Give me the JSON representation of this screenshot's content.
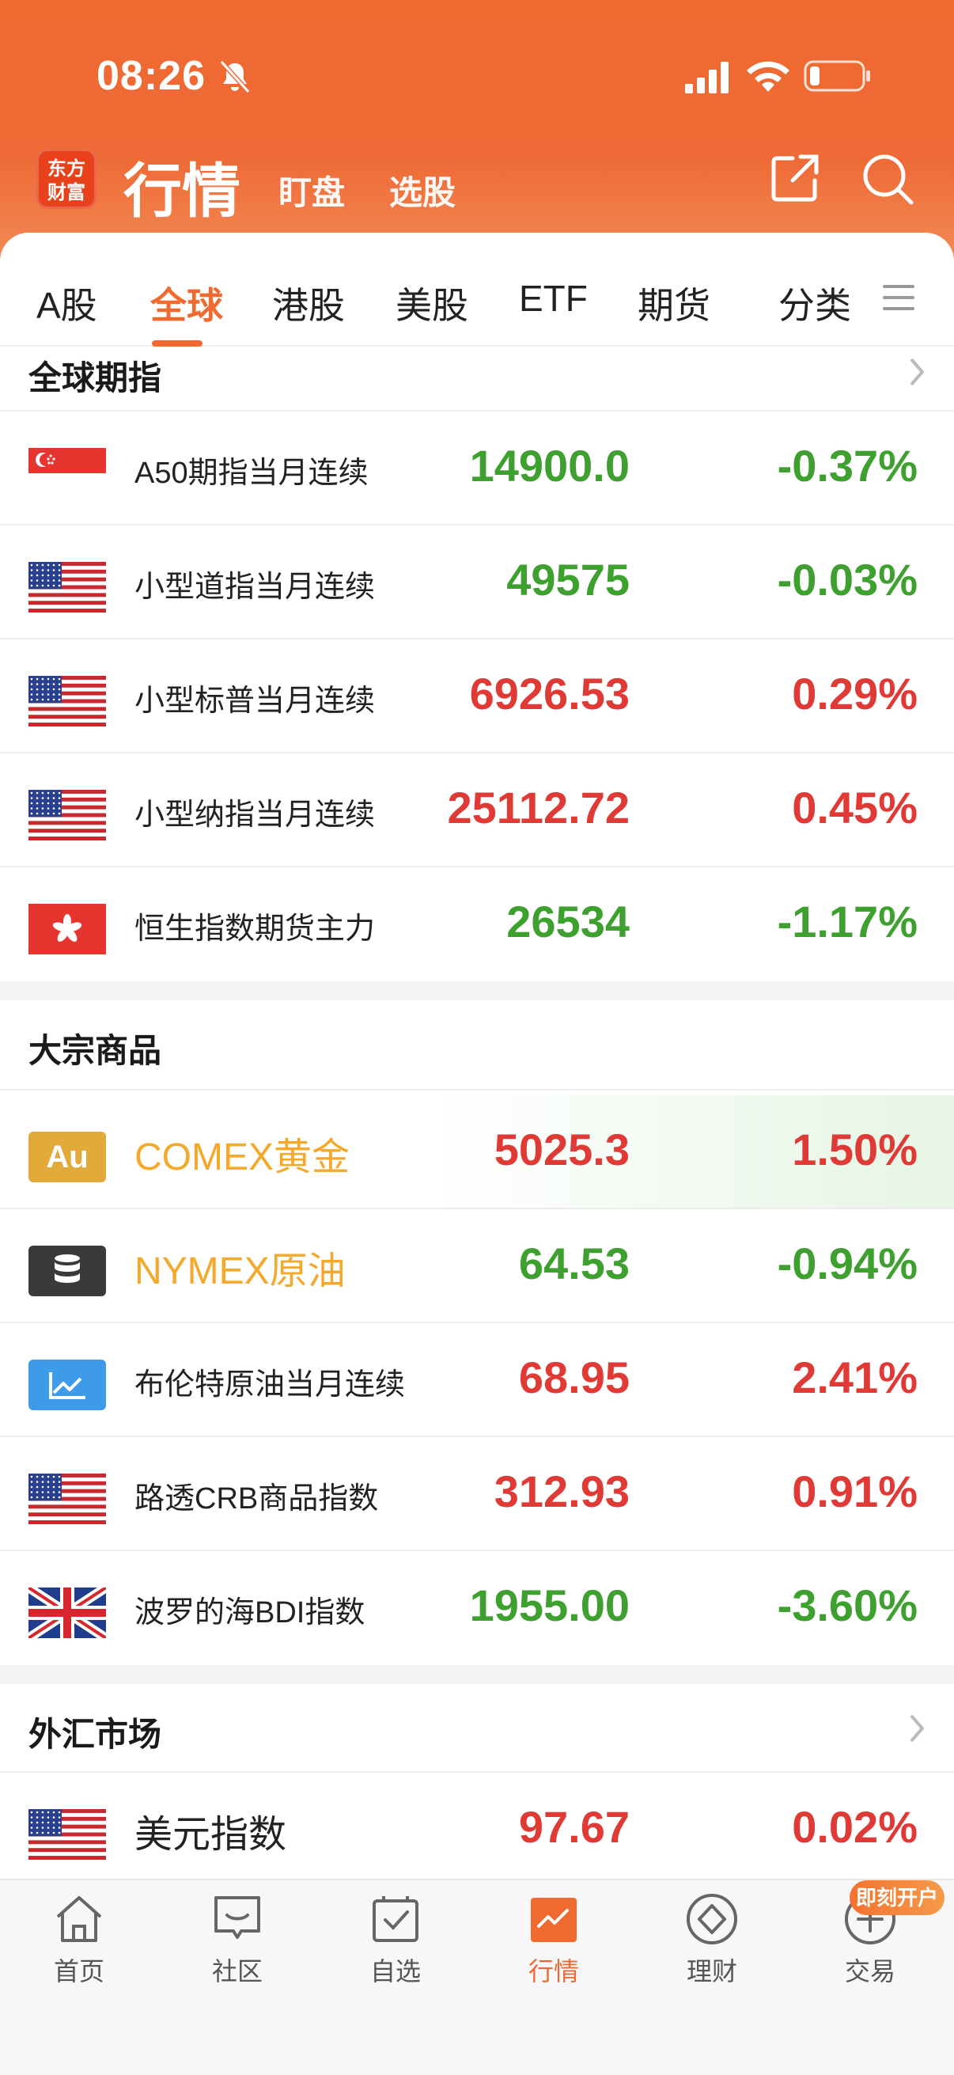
{
  "status": {
    "time": "08:26"
  },
  "app": {
    "logo_top": "东方",
    "logo_bottom": "财富",
    "title": "行情",
    "subtabs": [
      "盯盘",
      "选股"
    ]
  },
  "tabs": [
    "A股",
    "全球",
    "港股",
    "美股",
    "ETF",
    "期货",
    "分类"
  ],
  "active_tab": "全球",
  "sections": {
    "global_futures": {
      "title": "全球期指",
      "rows": [
        {
          "flag": "singapore-flag-icon",
          "name": "A50期指当月连续",
          "price": "14900.0",
          "pct": "-0.37%",
          "dir": "down"
        },
        {
          "flag": "us-flag-icon",
          "name": "小型道指当月连续",
          "price": "49575",
          "pct": "-0.03%",
          "dir": "down"
        },
        {
          "flag": "us-flag-icon",
          "name": "小型标普当月连续",
          "price": "6926.53",
          "pct": "0.29%",
          "dir": "up"
        },
        {
          "flag": "us-flag-icon",
          "name": "小型纳指当月连续",
          "price": "25112.72",
          "pct": "0.45%",
          "dir": "up"
        },
        {
          "flag": "hongkong-flag-icon",
          "name": "恒生指数期货主力",
          "price": "26534",
          "pct": "-1.17%",
          "dir": "down"
        }
      ]
    },
    "commodities": {
      "title": "大宗商品",
      "gold_badge": "Au",
      "rows": [
        {
          "flag": "gold-icon",
          "name": "COMEX黄金",
          "price": "5025.3",
          "pct": "1.50%",
          "dir": "up"
        },
        {
          "flag": "oil-barrel-icon",
          "name": "NYMEX原油",
          "price": "64.53",
          "pct": "-0.94%",
          "dir": "down"
        },
        {
          "flag": "line-chart-icon",
          "name": "布伦特原油当月连续",
          "price": "68.95",
          "pct": "2.41%",
          "dir": "up"
        },
        {
          "flag": "us-flag-icon",
          "name": "路透CRB商品指数",
          "price": "312.93",
          "pct": "0.91%",
          "dir": "up"
        },
        {
          "flag": "uk-flag-icon",
          "name": "波罗的海BDI指数",
          "price": "1955.00",
          "pct": "-3.60%",
          "dir": "down"
        }
      ]
    },
    "forex": {
      "title": "外汇市场",
      "rows": [
        {
          "flag": "us-flag-icon",
          "name": "美元指数",
          "price": "97.67",
          "pct": "0.02%",
          "dir": "up"
        }
      ]
    }
  },
  "bottom_nav": [
    "首页",
    "社区",
    "自选",
    "行情",
    "理财",
    "交易"
  ],
  "open_account_badge": "即刻开户",
  "colors": {
    "accent": "#f06a30",
    "up": "#e03a36",
    "down": "#3ea02f",
    "commodity_name": "#f4a92d"
  }
}
